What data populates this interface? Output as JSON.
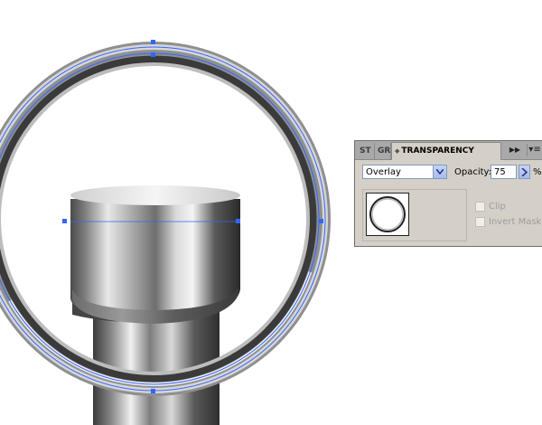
{
  "artboard": {
    "object": "metal-ring-and-cylinder",
    "selection_color": "#3366ff"
  },
  "panel": {
    "tabs": [
      {
        "label": "STR",
        "display": "ST"
      },
      {
        "label": "GR",
        "display": "GR"
      },
      {
        "label": "TRANSPARENCY",
        "display": "TRANSPARENCY",
        "active": true
      }
    ],
    "expand_icon": "double-arrow-right-icon",
    "menu_icon": "panel-menu-icon",
    "blend_mode": {
      "value": "Overlay",
      "options_visible": [
        "Overlay"
      ]
    },
    "opacity": {
      "label": "Opacity:",
      "value": "75",
      "unit": "%"
    },
    "clip": {
      "label": "Clip",
      "checked": false,
      "enabled": false
    },
    "invert_mask": {
      "label": "Invert Mask",
      "checked": false,
      "enabled": false
    },
    "thumbnail": {
      "icon": "ring-thumbnail-icon"
    }
  },
  "colors": {
    "panel_bg": "#d4d0c8",
    "tab_strip": "#a9a9a9",
    "dropdown_button": "#a8bbef"
  }
}
